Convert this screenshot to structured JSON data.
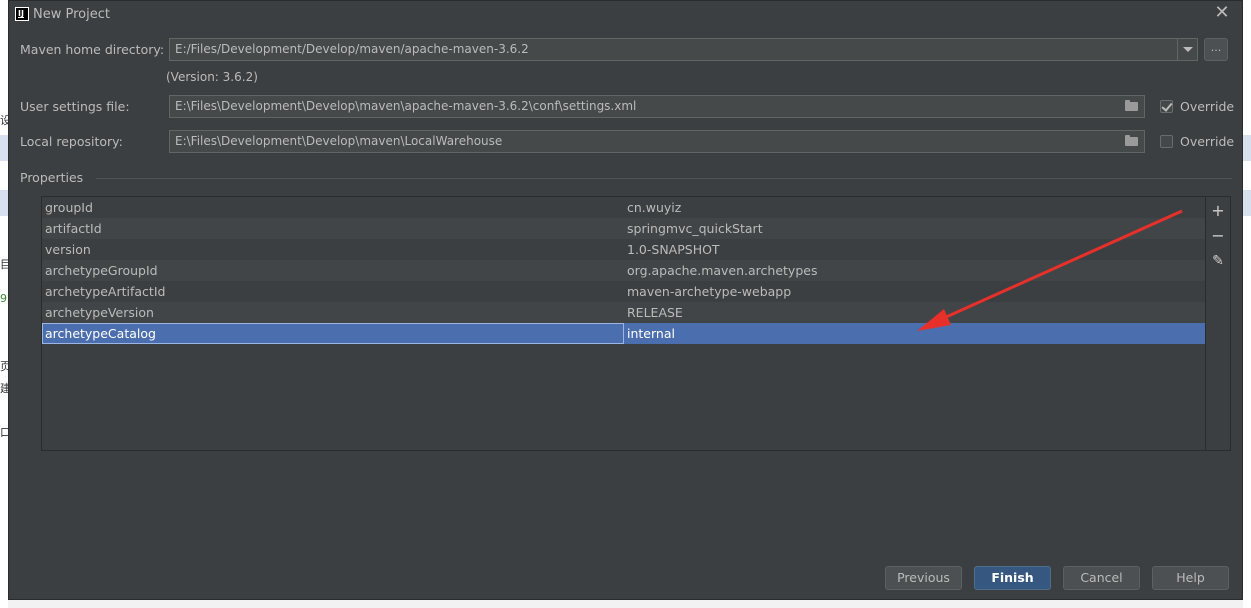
{
  "window": {
    "title": "New Project",
    "logo_text": "IJ"
  },
  "maven": {
    "home_label": "Maven home directory:",
    "home_value": "E:/Files/Development/Develop/maven/apache-maven-3.6.2",
    "version_text": "(Version: 3.6.2)",
    "browse_label": "...",
    "user_settings_label": "User settings file:",
    "user_settings_value": "E:\\Files\\Development\\Develop\\maven\\apache-maven-3.6.2\\conf\\settings.xml",
    "user_settings_override": true,
    "local_repo_label": "Local repository:",
    "local_repo_value": "E:\\Files\\Development\\Develop\\maven\\LocalWarehouse",
    "local_repo_override": false,
    "override_label": "Override"
  },
  "properties": {
    "section_label": "Properties",
    "rows": [
      {
        "key": "groupId",
        "value": "cn.wuyiz"
      },
      {
        "key": "artifactId",
        "value": "springmvc_quickStart"
      },
      {
        "key": "version",
        "value": "1.0-SNAPSHOT"
      },
      {
        "key": "archetypeGroupId",
        "value": "org.apache.maven.archetypes"
      },
      {
        "key": "archetypeArtifactId",
        "value": "maven-archetype-webapp"
      },
      {
        "key": "archetypeVersion",
        "value": "RELEASE"
      },
      {
        "key": "archetypeCatalog",
        "value": "internal"
      }
    ],
    "selected_index": 6,
    "toolbar": {
      "add": "+",
      "remove": "−",
      "edit": "✎"
    }
  },
  "buttons": {
    "previous": "Previous",
    "finish": "Finish",
    "cancel": "Cancel",
    "help": "Help"
  },
  "annotation": {
    "arrow_color": "#e8302a"
  },
  "background_fragments": [
    "设",
    "目",
    "9",
    "页",
    "建",
    "口"
  ]
}
